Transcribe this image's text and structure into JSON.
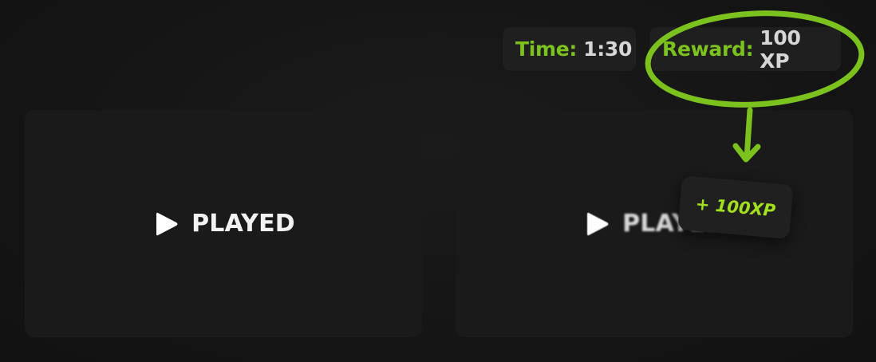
{
  "stats": {
    "time_label": "Time:",
    "time_value": "1:30",
    "reward_label": "Reward:",
    "reward_value": "100 XP"
  },
  "cards": [
    {
      "label": "PLAYED",
      "icon": "play-icon"
    },
    {
      "label": "PLAYED",
      "icon": "play-icon"
    }
  ],
  "toast": {
    "text": "+ 100XP"
  },
  "colors": {
    "accent_green": "#7cc21e",
    "annotation_green": "#7cc21e",
    "toast_text": "#a3e01f",
    "background": "#151515",
    "card": "#1a1a1a"
  }
}
